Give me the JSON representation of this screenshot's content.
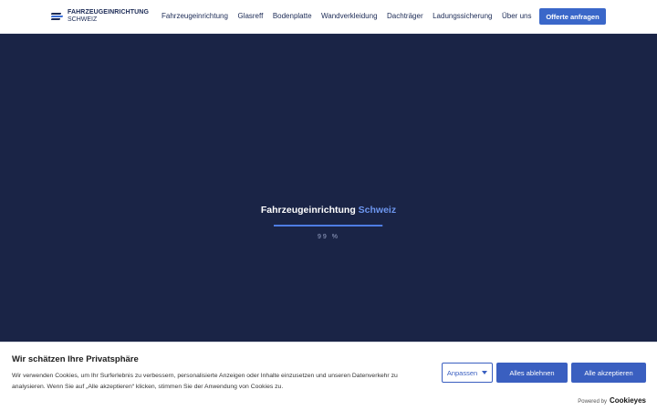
{
  "header": {
    "logo_line1": "FAHRZEUGEINRICHTUNG",
    "logo_line2": "SCHWEIZ",
    "nav": [
      {
        "label": "Fahrzeugeinrichtung"
      },
      {
        "label": "Glasreff"
      },
      {
        "label": "Bodenplatte"
      },
      {
        "label": "Wandverkleidung"
      },
      {
        "label": "Dachträger"
      },
      {
        "label": "Ladungssicherung"
      },
      {
        "label": "Über uns"
      }
    ],
    "cta_label": "Offerte anfragen"
  },
  "loader": {
    "title_main": "Fahrzeugeinrichtung",
    "title_accent": "Schweiz",
    "progress_text": "99 %",
    "progress": 0.99
  },
  "cookie": {
    "title": "Wir schätzen Ihre Privatsphäre",
    "text": "Wir verwenden Cookies, um Ihr Surferlebnis zu verbessern, personalisierte Anzeigen oder Inhalte einzusetzen und unseren Datenverkehr zu analysieren. Wenn Sie auf „Alle akzeptieren“ klicken, stimmen Sie der Anwendung von Cookies zu.",
    "customize_label": "Anpassen",
    "reject_label": "Alles ablehnen",
    "accept_label": "Alle akzeptieren",
    "powered_by": "Powered by",
    "brand": "Cookieyes"
  },
  "colors": {
    "background": "#1a2446",
    "accent": "#3a67c9",
    "title_accent": "#6d96ef"
  }
}
